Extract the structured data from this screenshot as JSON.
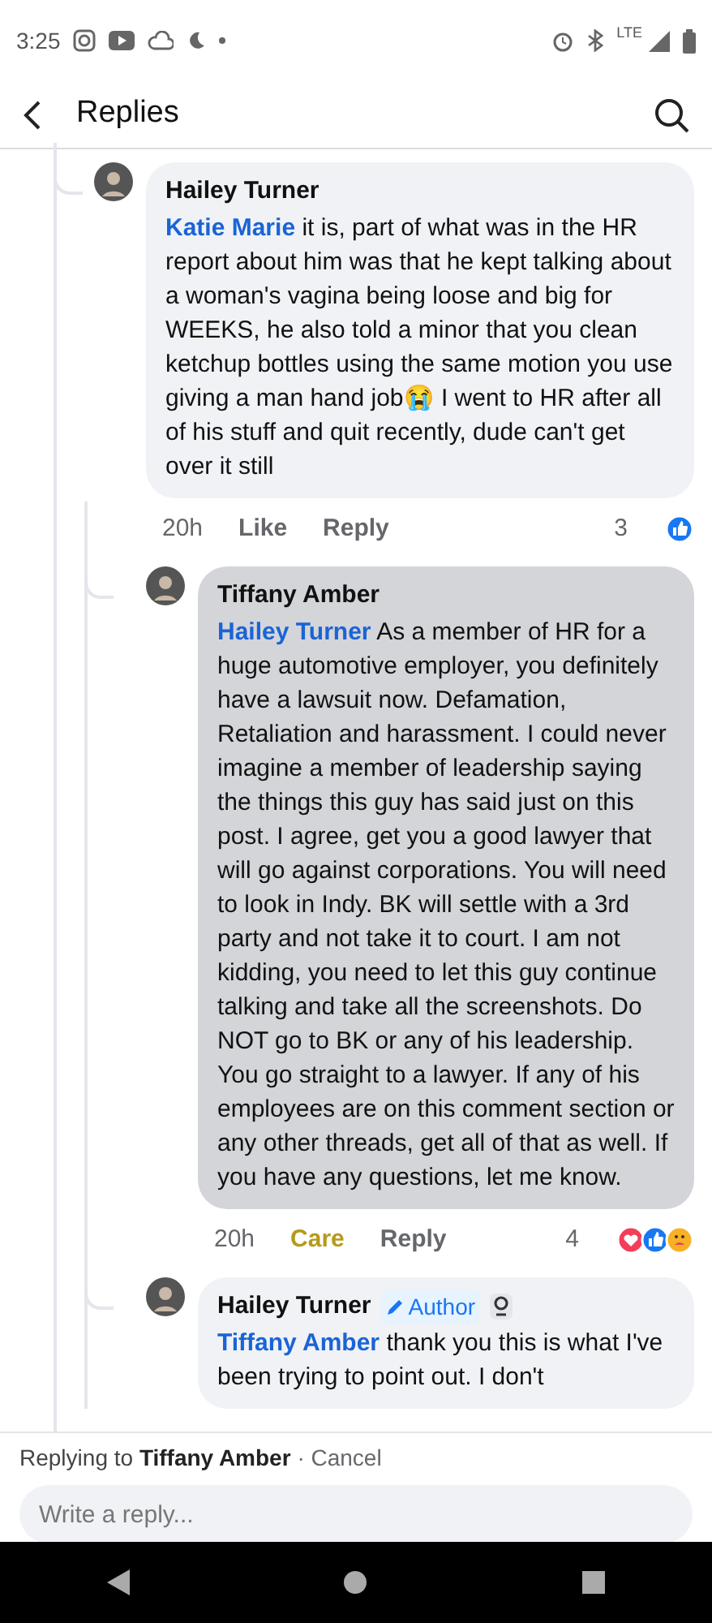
{
  "status_bar": {
    "time": "3:25",
    "network": "LTE"
  },
  "header": {
    "title": "Replies"
  },
  "comments": [
    {
      "author": "Hailey Turner",
      "selected": false,
      "mention": "Katie Marie",
      "text": "it is, part of what was in the HR report about him was that he kept talking about a woman's vagina being loose and big for WEEKS, he also told a minor that you clean ketchup bottles using the same motion you use giving a man hand job😭 I went to HR after all of his stuff and quit recently, dude can't get over it still",
      "time": "20h",
      "reaction_label": "Like",
      "reacted": false,
      "reply_label": "Reply",
      "reaction_count": "3",
      "reaction_icons": [
        {
          "kind": "like"
        }
      ],
      "children": [
        {
          "author": "Tiffany Amber",
          "selected": true,
          "mention": "Hailey Turner",
          "text": "As a member of HR for a huge automotive employer, you definitely have a lawsuit now. Defamation, Retaliation and harassment. I could never imagine a member of leadership saying the things this guy has said just on this post. I agree, get you a good lawyer that will go against corporations. You will need to look in Indy. BK will settle with a 3rd party and not take it to court. I am not kidding, you need to let this guy continue talking and take all the screenshots. Do NOT go to BK or any of his leadership. You go straight to a lawyer. If any of his employees are on this comment section or any other threads, get all of that as well. If you have any questions, let me know.",
          "time": "20h",
          "reaction_label": "Care",
          "reacted": true,
          "reply_label": "Reply",
          "reaction_count": "4",
          "reaction_icons": [
            {
              "kind": "love"
            },
            {
              "kind": "like"
            },
            {
              "kind": "care"
            }
          ]
        },
        {
          "author": "Hailey Turner",
          "badge_label": "Author",
          "selected": false,
          "mention": "Tiffany Amber",
          "text": "thank you this is what I've been trying to point out. I don't"
        }
      ]
    }
  ],
  "reply_bar": {
    "prefix": "Replying to",
    "target": "Tiffany Amber",
    "cancel": "· Cancel",
    "placeholder": "Write a reply..."
  }
}
